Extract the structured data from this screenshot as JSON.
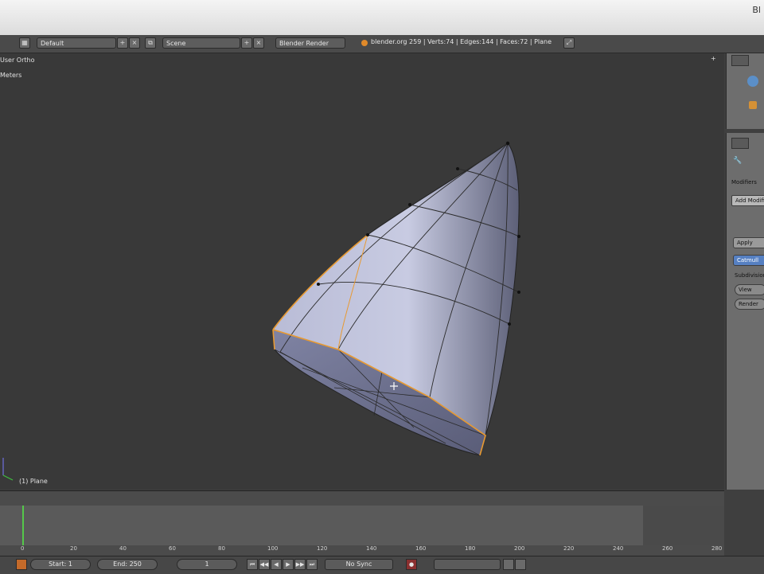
{
  "window": {
    "title": "Bl"
  },
  "info_header": {
    "layout": "Default",
    "scene": "Scene",
    "renderer": "Blender Render",
    "stats": "blender.org 259 | Verts:74 | Edges:144 | Faces:72 | Plane"
  },
  "viewport": {
    "view_label": "User Ortho",
    "sub_label": "Meters",
    "object_label": "(1) Plane"
  },
  "properties": {
    "modifiers_label": "Modifiers",
    "add_modifier": "Add Modifier",
    "apply": "Apply",
    "catmull": "Catmull",
    "subdivisions": "Subdivisions:",
    "view": "View",
    "render": "Render"
  },
  "timeline": {
    "ticks": [
      "0",
      "20",
      "40",
      "60",
      "80",
      "100",
      "120",
      "140",
      "160",
      "180",
      "200",
      "220",
      "240",
      "260",
      "280"
    ],
    "current_frame_marker": "1"
  },
  "playback": {
    "start": "Start: 1",
    "end": "End: 250",
    "current": "1",
    "sync": "No Sync"
  },
  "colors": {
    "viewport_bg": "#393939",
    "selection_orange": "#e89a32",
    "mesh_fill": "#9ea3c4"
  }
}
